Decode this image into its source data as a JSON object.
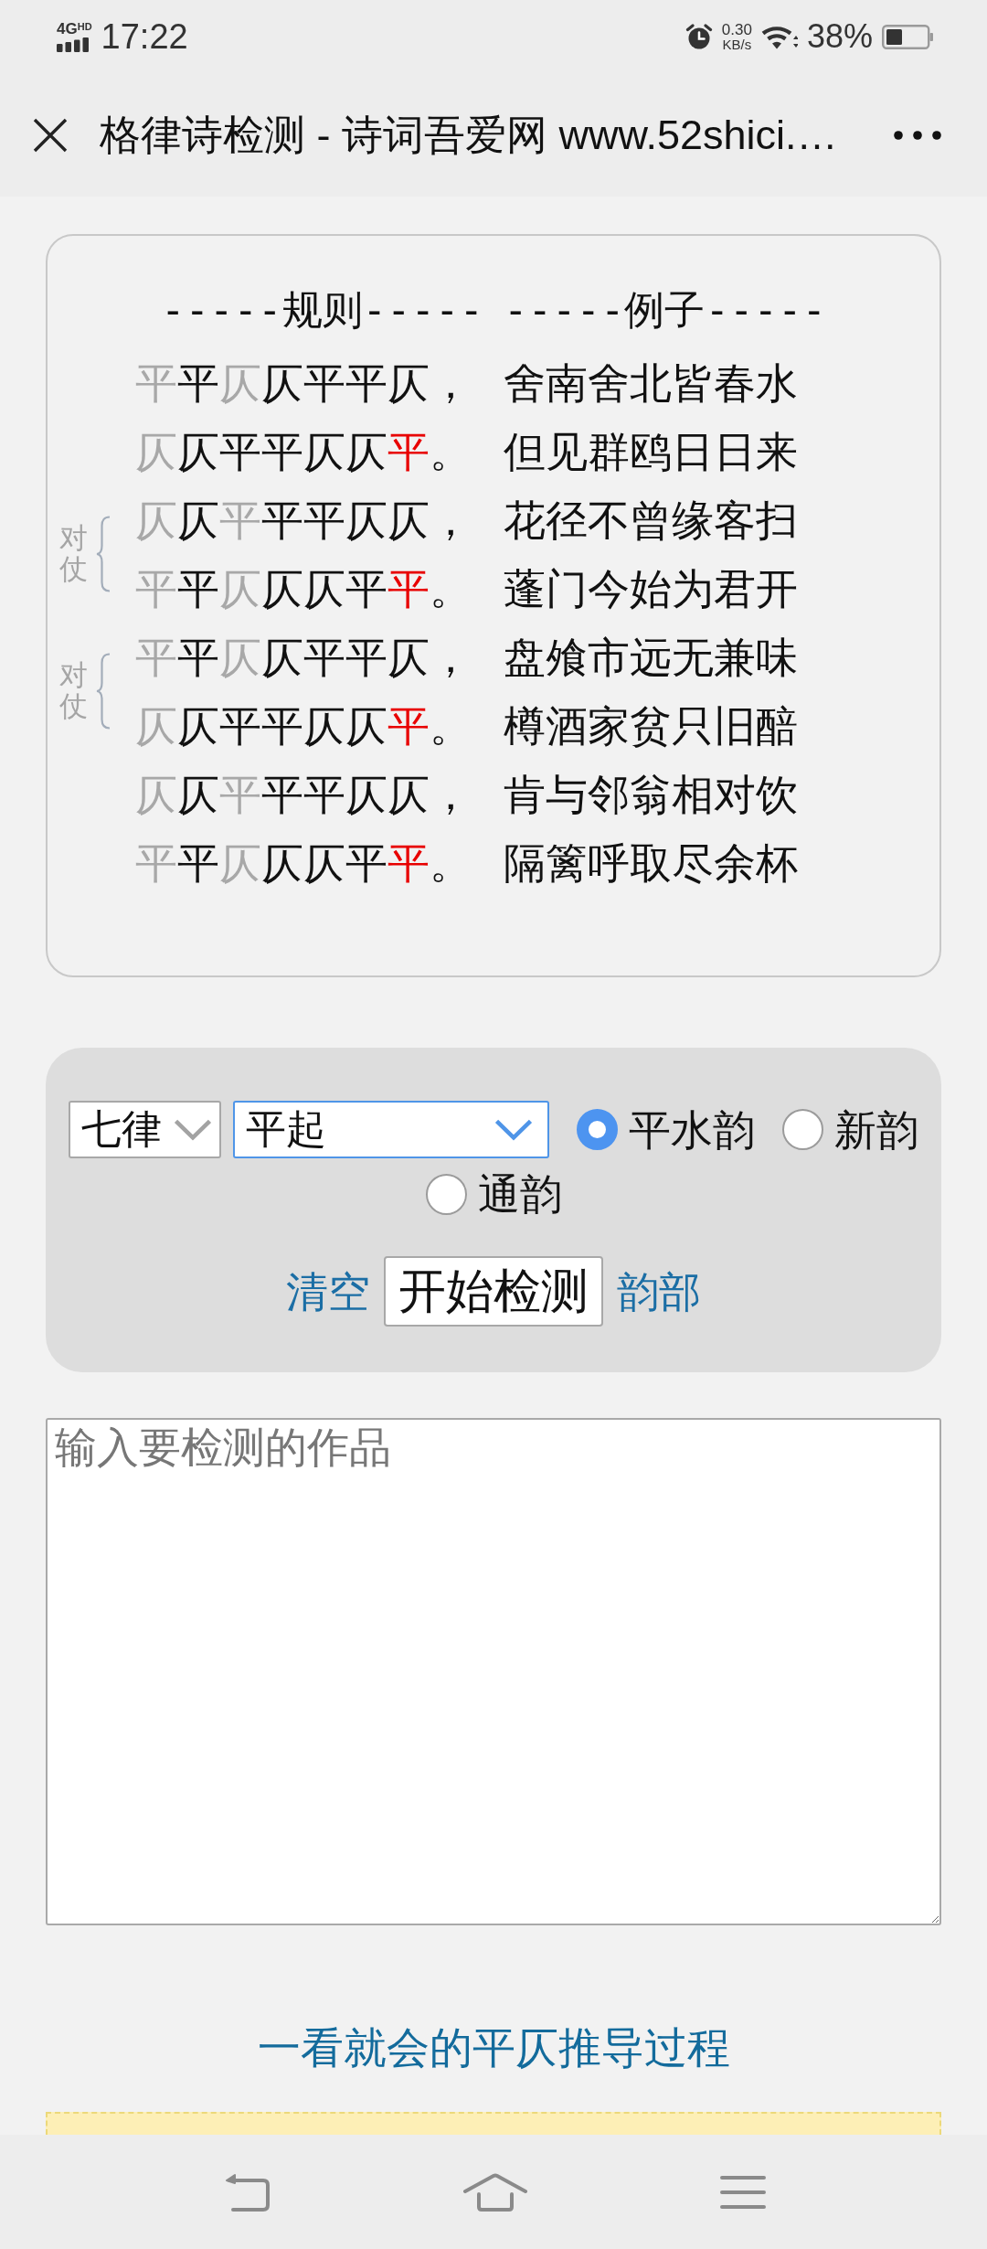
{
  "status_bar": {
    "network": "4G",
    "network_badge": "HD",
    "time": "17:22",
    "speed_value": "0.30",
    "speed_unit": "KB/s",
    "battery": "38%"
  },
  "header": {
    "title": "格律诗检测 - 诗词吾爱网 www.52shici.…"
  },
  "rules_card": {
    "headings": [
      "-----规则-----",
      "-----例子-----"
    ],
    "couplets": [
      {
        "lines": [
          {
            "tones": [
              {
                "char": "平",
                "kind": "either"
              },
              {
                "char": "平",
                "kind": "fixed"
              },
              {
                "char": "仄",
                "kind": "either"
              },
              {
                "char": "仄",
                "kind": "fixed"
              },
              {
                "char": "平",
                "kind": "fixed"
              },
              {
                "char": "平",
                "kind": "fixed"
              },
              {
                "char": "仄",
                "kind": "fixed"
              }
            ],
            "punctuation": "，",
            "example": "舍南舍北皆春水"
          },
          {
            "tones": [
              {
                "char": "仄",
                "kind": "either"
              },
              {
                "char": "仄",
                "kind": "fixed"
              },
              {
                "char": "平",
                "kind": "fixed"
              },
              {
                "char": "平",
                "kind": "fixed"
              },
              {
                "char": "仄",
                "kind": "fixed"
              },
              {
                "char": "仄",
                "kind": "fixed"
              },
              {
                "char": "平",
                "kind": "rhyme"
              }
            ],
            "punctuation": "。",
            "example": "但见群鸥日日来"
          }
        ]
      },
      {
        "label": "对仗",
        "lines": [
          {
            "tones": [
              {
                "char": "仄",
                "kind": "either"
              },
              {
                "char": "仄",
                "kind": "fixed"
              },
              {
                "char": "平",
                "kind": "either"
              },
              {
                "char": "平",
                "kind": "fixed"
              },
              {
                "char": "平",
                "kind": "fixed"
              },
              {
                "char": "仄",
                "kind": "fixed"
              },
              {
                "char": "仄",
                "kind": "fixed"
              }
            ],
            "punctuation": "，",
            "example": "花径不曾缘客扫"
          },
          {
            "tones": [
              {
                "char": "平",
                "kind": "either"
              },
              {
                "char": "平",
                "kind": "fixed"
              },
              {
                "char": "仄",
                "kind": "either"
              },
              {
                "char": "仄",
                "kind": "fixed"
              },
              {
                "char": "仄",
                "kind": "fixed"
              },
              {
                "char": "平",
                "kind": "fixed"
              },
              {
                "char": "平",
                "kind": "rhyme"
              }
            ],
            "punctuation": "。",
            "example": "蓬门今始为君开"
          }
        ]
      },
      {
        "label": "对仗",
        "lines": [
          {
            "tones": [
              {
                "char": "平",
                "kind": "either"
              },
              {
                "char": "平",
                "kind": "fixed"
              },
              {
                "char": "仄",
                "kind": "either"
              },
              {
                "char": "仄",
                "kind": "fixed"
              },
              {
                "char": "平",
                "kind": "fixed"
              },
              {
                "char": "平",
                "kind": "fixed"
              },
              {
                "char": "仄",
                "kind": "fixed"
              }
            ],
            "punctuation": "，",
            "example": "盘飧市远无兼味"
          },
          {
            "tones": [
              {
                "char": "仄",
                "kind": "either"
              },
              {
                "char": "仄",
                "kind": "fixed"
              },
              {
                "char": "平",
                "kind": "fixed"
              },
              {
                "char": "平",
                "kind": "fixed"
              },
              {
                "char": "仄",
                "kind": "fixed"
              },
              {
                "char": "仄",
                "kind": "fixed"
              },
              {
                "char": "平",
                "kind": "rhyme"
              }
            ],
            "punctuation": "。",
            "example": "樽酒家贫只旧醅"
          }
        ]
      },
      {
        "lines": [
          {
            "tones": [
              {
                "char": "仄",
                "kind": "either"
              },
              {
                "char": "仄",
                "kind": "fixed"
              },
              {
                "char": "平",
                "kind": "either"
              },
              {
                "char": "平",
                "kind": "fixed"
              },
              {
                "char": "平",
                "kind": "fixed"
              },
              {
                "char": "仄",
                "kind": "fixed"
              },
              {
                "char": "仄",
                "kind": "fixed"
              }
            ],
            "punctuation": "，",
            "example": "肯与邻翁相对饮"
          },
          {
            "tones": [
              {
                "char": "平",
                "kind": "either"
              },
              {
                "char": "平",
                "kind": "fixed"
              },
              {
                "char": "仄",
                "kind": "either"
              },
              {
                "char": "仄",
                "kind": "fixed"
              },
              {
                "char": "仄",
                "kind": "fixed"
              },
              {
                "char": "平",
                "kind": "fixed"
              },
              {
                "char": "平",
                "kind": "rhyme"
              }
            ],
            "punctuation": "。",
            "example": "隔篱呼取尽余杯"
          }
        ]
      }
    ]
  },
  "form": {
    "selects": [
      {
        "value": "七律",
        "focused": false
      },
      {
        "value": "平起",
        "focused": true
      }
    ],
    "rhyme_options": [
      {
        "label": "平水韵",
        "selected": true
      },
      {
        "label": "新韵",
        "selected": false
      },
      {
        "label": "通韵",
        "selected": false
      }
    ],
    "clear_link": "清空",
    "submit_button": "开始检测",
    "rhyme_link": "韵部"
  },
  "poem_input": {
    "placeholder": "输入要检测的作品"
  },
  "guide_link": "一看就会的平仄推导过程"
}
